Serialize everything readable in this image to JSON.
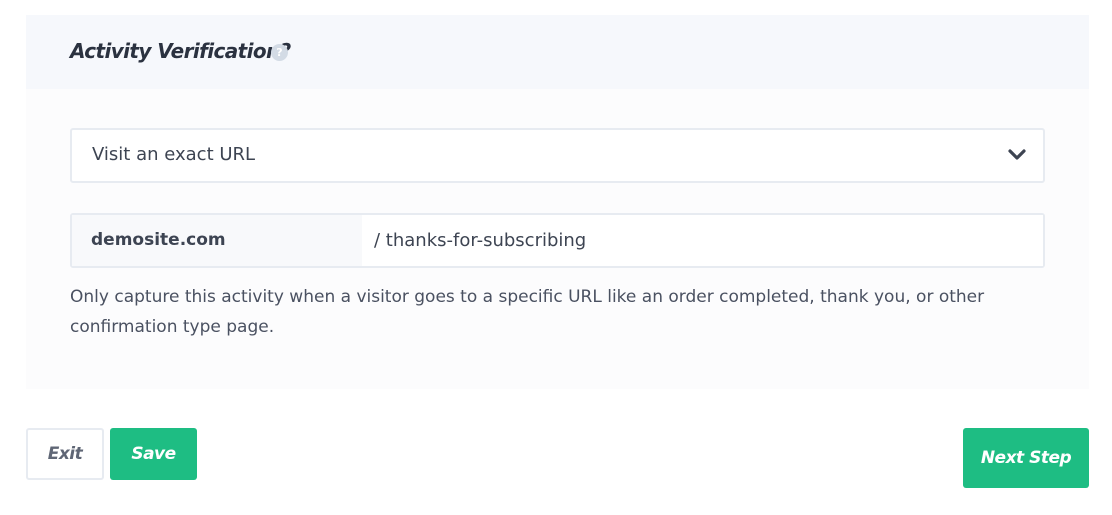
{
  "activity": {
    "title": "Activity Verification?",
    "help_glyph": "?"
  },
  "select": {
    "value": "Visit an exact URL",
    "icon": "chevron-down-icon"
  },
  "url": {
    "domain": "demosite.com",
    "path_value": "/ thanks-for-subscribing"
  },
  "help_text": "Only capture this activity when a visitor goes to a specific URL like an order completed, thank you, or other confirmation type page.",
  "buttons": {
    "exit": "Exit",
    "save": "Save",
    "next": "Next Step"
  },
  "colors": {
    "accent": "#1ebd83",
    "panel_header": "#f6f8fc",
    "border": "#e7ebf1"
  }
}
